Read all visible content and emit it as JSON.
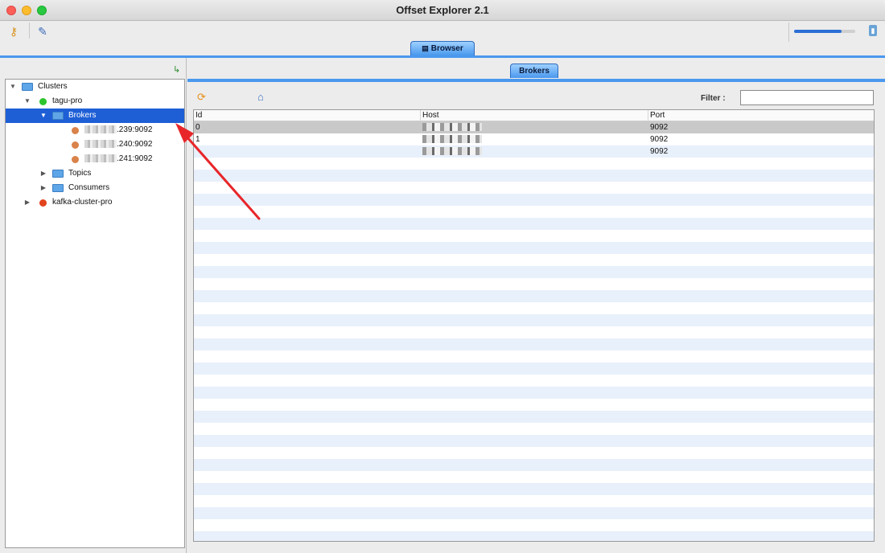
{
  "window": {
    "title": "Offset Explorer  2.1"
  },
  "toolbar": {
    "icons": [
      "connect-icon",
      "wand-icon"
    ],
    "progress": 0.78
  },
  "top_tab": {
    "label": "Browser",
    "icon": "browser-icon"
  },
  "left": {
    "tree": [
      {
        "label": "Clusters",
        "icon": "folder-icon",
        "expanded": true
      },
      {
        "label": "tagu-pro",
        "icon": "green-dot",
        "expanded": true
      },
      {
        "label": "Brokers",
        "icon": "folder-icon",
        "expanded": true,
        "selected": true
      },
      {
        "label": ".239:9092",
        "icon": "orange-dot"
      },
      {
        "label": ".240:9092",
        "icon": "orange-dot"
      },
      {
        "label": ".241:9092",
        "icon": "orange-dot"
      },
      {
        "label": "Topics",
        "icon": "folder-icon",
        "expanded": false
      },
      {
        "label": "Consumers",
        "icon": "folder-icon",
        "expanded": false
      },
      {
        "label": "kafka-cluster-pro",
        "icon": "red-dot",
        "expanded": false
      }
    ]
  },
  "right": {
    "tab": {
      "label": "Brokers"
    },
    "filter": {
      "label": "Filter :",
      "value": ""
    },
    "table": {
      "columns": [
        "Id",
        "Host",
        "Port"
      ],
      "rows": [
        {
          "id": "0",
          "host": "",
          "port": "9092"
        },
        {
          "id": "1",
          "host": "",
          "port": "9092"
        },
        {
          "id": "",
          "host": "",
          "port": "9092"
        }
      ]
    }
  },
  "colors": {
    "accent": "#4a98ee",
    "selection": "#1e5fd6",
    "annotation_arrow": "#e8262a"
  }
}
